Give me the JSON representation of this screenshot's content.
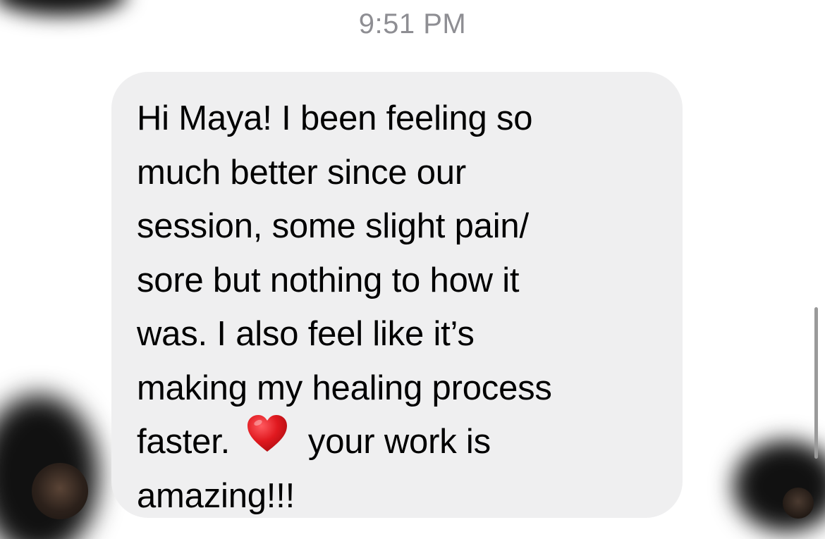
{
  "conversation": {
    "timestamp": "9:51 PM",
    "message": {
      "lines": [
        "Hi Maya! I been feeling so",
        "much better since our",
        "session, some slight pain/",
        "sore but nothing to how it",
        "was. I also feel like it’s",
        "making my healing process",
        "faster.",
        "your work is",
        "amazing!!!"
      ],
      "emoji": "red-heart-icon"
    }
  },
  "colors": {
    "bubble": "#efeff0",
    "timestamp": "#8e8e93",
    "heart": "#e0191f"
  }
}
